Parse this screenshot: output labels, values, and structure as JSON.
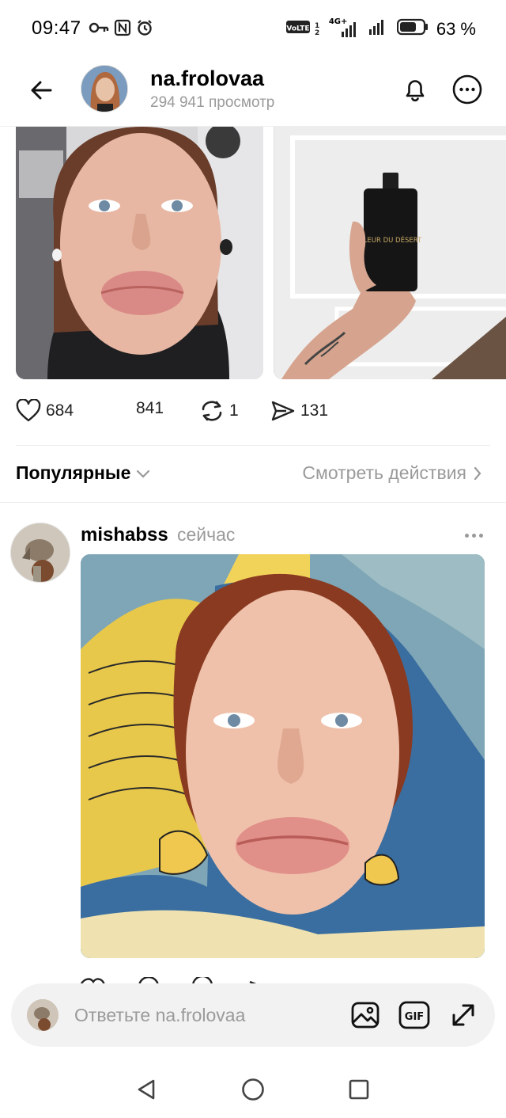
{
  "status_bar": {
    "time": "09:47",
    "battery_percent": "63 %",
    "network_label": "4G+",
    "volte_label": "VoLTE",
    "icons": [
      "key-icon",
      "nfc-icon",
      "alarm-icon",
      "volte-icon",
      "signal-icon",
      "signal-icon",
      "battery-icon"
    ]
  },
  "header": {
    "username": "na.frolovaa",
    "views": "294 941 просмотр",
    "icons": [
      "back-arrow-icon",
      "bell-icon",
      "more-icon"
    ]
  },
  "post_stats": {
    "likes": "684",
    "comments": "841",
    "reposts": "1",
    "shares": "131"
  },
  "sort": {
    "label": "Популярные",
    "actions_link": "Смотреть действия"
  },
  "reply": {
    "username": "mishabss",
    "time": "сейчас"
  },
  "photo_2": {
    "bottle_label": "FLEUR DU DÉSERT"
  },
  "reply_bar": {
    "placeholder": "Ответьте na.frolovaa",
    "gif_label": "GIF"
  },
  "colors": {
    "text_primary": "#000000",
    "text_secondary": "#9a9a9a",
    "divider": "#ececec",
    "reply_bar_bg": "#f2f2f2"
  }
}
